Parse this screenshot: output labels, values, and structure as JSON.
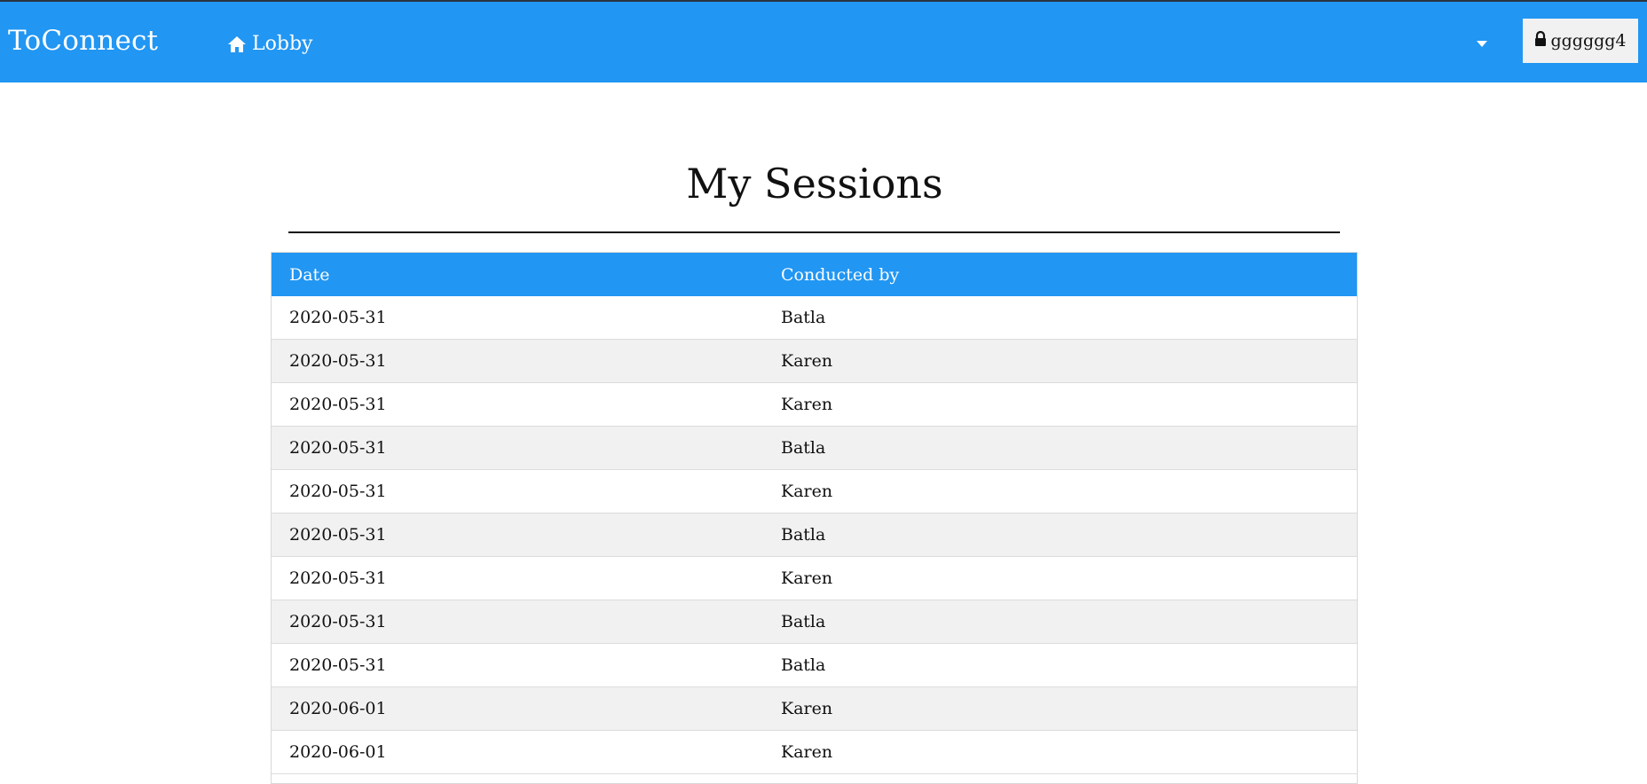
{
  "app": {
    "brand": "ToConnect",
    "nav": {
      "lobby_label": "Lobby",
      "lobby_icon": "home-icon"
    },
    "user": {
      "name": "gggggg4",
      "icon": "lock-icon"
    },
    "colors": {
      "primary": "#2196f3",
      "row_alt": "#f1f1f1"
    }
  },
  "page": {
    "title": "My Sessions"
  },
  "table": {
    "headers": [
      "Date",
      "Conducted by"
    ],
    "rows": [
      [
        "2020-05-31",
        "Batla"
      ],
      [
        "2020-05-31",
        "Karen"
      ],
      [
        "2020-05-31",
        "Karen"
      ],
      [
        "2020-05-31",
        "Batla"
      ],
      [
        "2020-05-31",
        "Karen"
      ],
      [
        "2020-05-31",
        "Batla"
      ],
      [
        "2020-05-31",
        "Karen"
      ],
      [
        "2020-05-31",
        "Batla"
      ],
      [
        "2020-05-31",
        "Batla"
      ],
      [
        "2020-06-01",
        "Karen"
      ],
      [
        "2020-06-01",
        "Karen"
      ]
    ]
  }
}
